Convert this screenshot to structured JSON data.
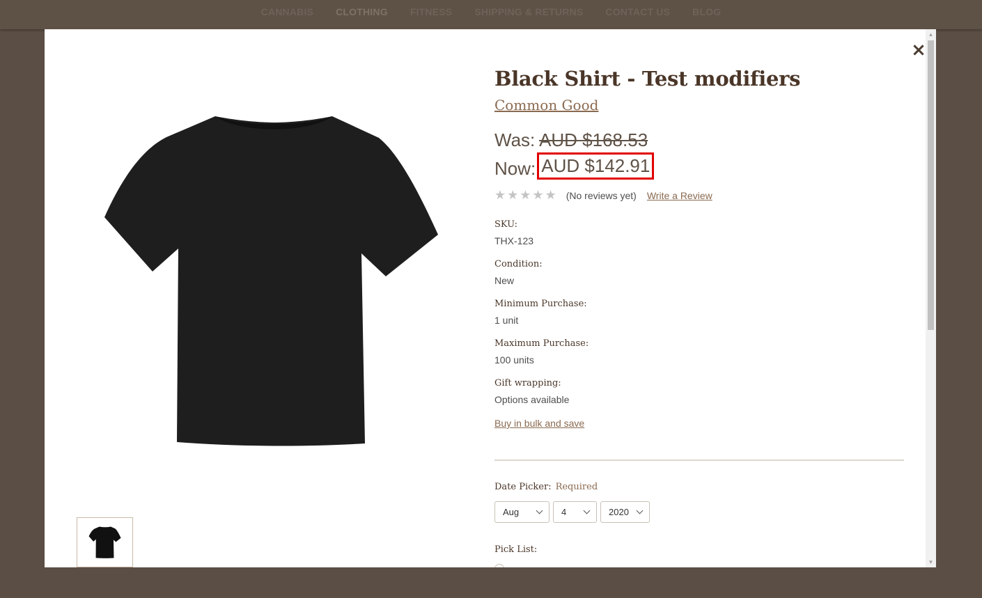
{
  "nav": {
    "items": [
      "CANNABIS",
      "CLOTHING",
      "FITNESS",
      "SHIPPING & RETURNS",
      "CONTACT US",
      "BLOG"
    ]
  },
  "modal": {
    "close_icon": "close-icon",
    "product": {
      "title": "Black Shirt - Test modifiers",
      "brand": "Common Good",
      "was_label": "Was:",
      "was_price": "AUD $168.53",
      "now_label": "Now:",
      "now_price": "AUD $142.91",
      "rating": 0,
      "rating_max": 5,
      "no_reviews": "(No reviews yet)",
      "write_review": "Write a Review",
      "specs": [
        {
          "label": "SKU:",
          "value": "THX-123"
        },
        {
          "label": "Condition:",
          "value": "New"
        },
        {
          "label": "Minimum Purchase:",
          "value": "1 unit"
        },
        {
          "label": "Maximum Purchase:",
          "value": "100 units"
        },
        {
          "label": "Gift wrapping:",
          "value": "Options available"
        }
      ],
      "bulk_link": "Buy in bulk and save"
    },
    "options": {
      "date_picker_label": "Date Picker:",
      "required_label": "Required",
      "month": "Aug",
      "day": "4",
      "year": "2020",
      "pick_list_label": "Pick List:"
    }
  },
  "colors": {
    "accent": "#8a6a50",
    "title": "#4a3628",
    "highlight_border": "#e10000",
    "overlay": "#5b4e44"
  }
}
